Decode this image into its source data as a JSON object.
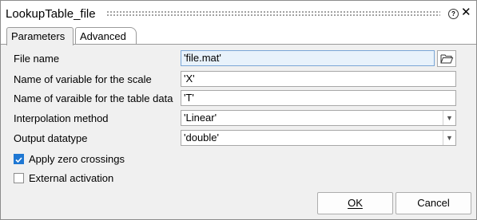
{
  "window": {
    "title": "LookupTable_file"
  },
  "tabs": [
    {
      "label": "Parameters",
      "active": true
    },
    {
      "label": "Advanced",
      "active": false
    }
  ],
  "fields": {
    "file_name": {
      "label": "File name",
      "value": "'file.mat'"
    },
    "scale_var": {
      "label": "Name of variable for the scale",
      "value": "'X'"
    },
    "table_var": {
      "label": "Name of varaible for the table data",
      "value": "'T'"
    },
    "interp": {
      "label": "Interpolation method",
      "value": "'Linear'"
    },
    "dtype": {
      "label": "Output datatype",
      "value": "'double'"
    }
  },
  "checkboxes": {
    "zero_crossings": {
      "label": "Apply zero crossings",
      "checked": true
    },
    "ext_activation": {
      "label": "External activation",
      "checked": false
    }
  },
  "buttons": {
    "ok": "OK",
    "cancel": "Cancel"
  },
  "icons": {
    "help": "help-icon",
    "close": "close-icon",
    "browse": "folder-open-icon",
    "dropdown": "chevron-down-icon"
  },
  "colors": {
    "accent": "#1e77d3",
    "file_field_bg": "#e8f2fb"
  }
}
